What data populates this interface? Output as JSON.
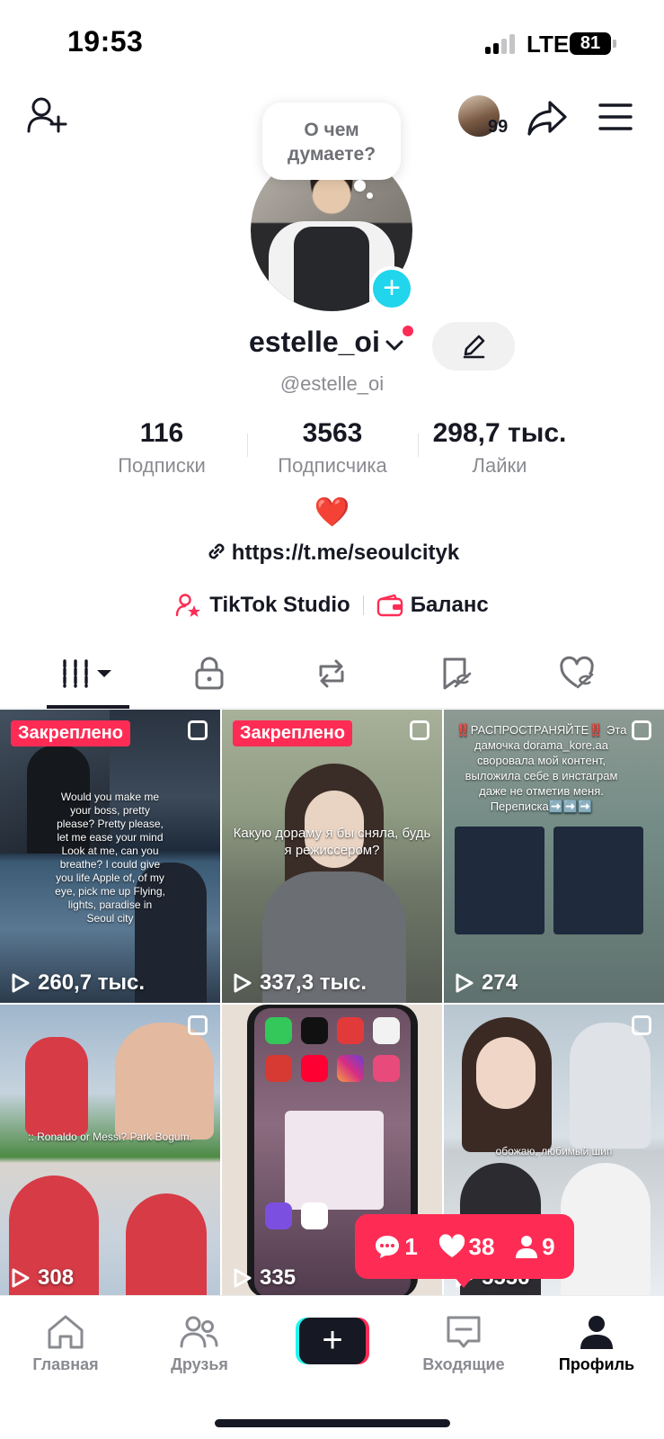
{
  "status_bar": {
    "time": "19:53",
    "network": "LTE",
    "battery": "81"
  },
  "top_bar": {
    "add_friend_icon": "person-plus-icon",
    "avatar_badge": "99",
    "share_icon": "share-icon",
    "menu_icon": "hamburger-menu-icon"
  },
  "profile": {
    "thought_bubble_line1": "О чем",
    "thought_bubble_line2": "думаете?",
    "username": "estelle_oi",
    "handle": "@estelle_oi",
    "add_avatar_symbol": "+",
    "bio_emoji": "❤️",
    "link": "https://t.me/seoulcityk"
  },
  "stats": [
    {
      "value": "116",
      "label": "Подписки"
    },
    {
      "value": "3563",
      "label": "Подписчика"
    },
    {
      "value": "298,7 тыс.",
      "label": "Лайки"
    }
  ],
  "tools": {
    "studio_label": "TikTok Studio",
    "balance_label": "Баланс"
  },
  "tabs": [
    "videos-grid-icon",
    "lock-icon",
    "repost-icon",
    "favorites-icon",
    "liked-icon"
  ],
  "videos": [
    {
      "views": "260,7 тыс.",
      "pinned_label": "Закреплено",
      "caption": "Would you make me your boss, pretty please? Pretty please, let me ease your mind Look at me, can you breathe? I could give you life Apple of, of my eye, pick me up Flying, lights, paradise in Seoul city"
    },
    {
      "views": "337,3 тыс.",
      "pinned_label": "Закреплено",
      "caption": "Какую дораму я бы сняла, будь я режиссером?"
    },
    {
      "views": "274",
      "caption": "‼️РАСПРОСТРАНЯЙТЕ‼️ Эта дамочка dorama_kore.aa своровала мой контент, выложила себе в инстаграм даже не отметив меня. Переписка➡️➡️➡️"
    },
    {
      "views": "308",
      "caption": ":: Ronaldo or Messi? Park Bogum."
    },
    {
      "views": "335",
      "caption": ""
    },
    {
      "views": "5556",
      "caption": "обожаю, любимый шип"
    }
  ],
  "notification": {
    "comments": "1",
    "likes": "38",
    "followers": "9"
  },
  "bottom_nav": [
    {
      "label": "Главная",
      "icon": "home-icon"
    },
    {
      "label": "Друзья",
      "icon": "friends-icon"
    },
    {
      "label": "",
      "icon": "create-plus-icon"
    },
    {
      "label": "Входящие",
      "icon": "inbox-icon"
    },
    {
      "label": "Профиль",
      "icon": "profile-icon"
    }
  ],
  "colors": {
    "accent": "#fe2c55",
    "cyan": "#20d5ec",
    "text": "#161823",
    "muted": "#8a8b91"
  }
}
